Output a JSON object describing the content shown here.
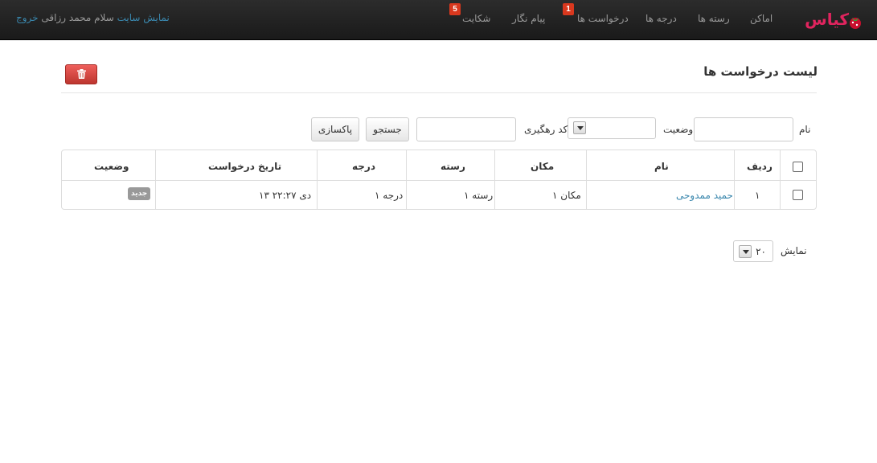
{
  "navbar": {
    "brand": "کیاس",
    "items": [
      {
        "label": "اماکن"
      },
      {
        "label": "رسته ها"
      },
      {
        "label": "درجه ها"
      },
      {
        "label": "درخواست ها",
        "badge": "1"
      },
      {
        "label": "پیام نگار"
      },
      {
        "label": "شکایت",
        "badge": "5"
      }
    ],
    "show_site": "نمایش سایت",
    "greeting": "سلام محمد رزاقی",
    "logout": "خروج"
  },
  "page": {
    "title": "لیست درخواست ها",
    "delete_icon": "trash-icon"
  },
  "filters": {
    "name_label": "نام",
    "name_value": "",
    "status_label": "وضعیت",
    "status_value": "",
    "tracking_label": "کد رهگیری",
    "tracking_value": "",
    "search_button": "جستجو",
    "clear_button": "پاکسازی"
  },
  "table": {
    "columns": [
      "ردیف",
      "نام",
      "مکان",
      "رسته",
      "درجه",
      "تاریخ درخواست",
      "وضعیت"
    ],
    "rows": [
      {
        "index": "۱",
        "name": "حمید ممدوحی",
        "place": "مکان ۱",
        "category": "رسته ۱",
        "grade": "درجه ۱",
        "date": "۱۳ دی ۲۲:۲۷",
        "status": "جدید"
      }
    ]
  },
  "pagination": {
    "show_label": "نمایش",
    "page_size": "۲۰"
  },
  "colors": {
    "navbar_bg": "#1f1f1f",
    "link": "#3a87ad",
    "badge": "#d9381e",
    "delete_button": "#da4f49",
    "brand": "#e0245e"
  }
}
